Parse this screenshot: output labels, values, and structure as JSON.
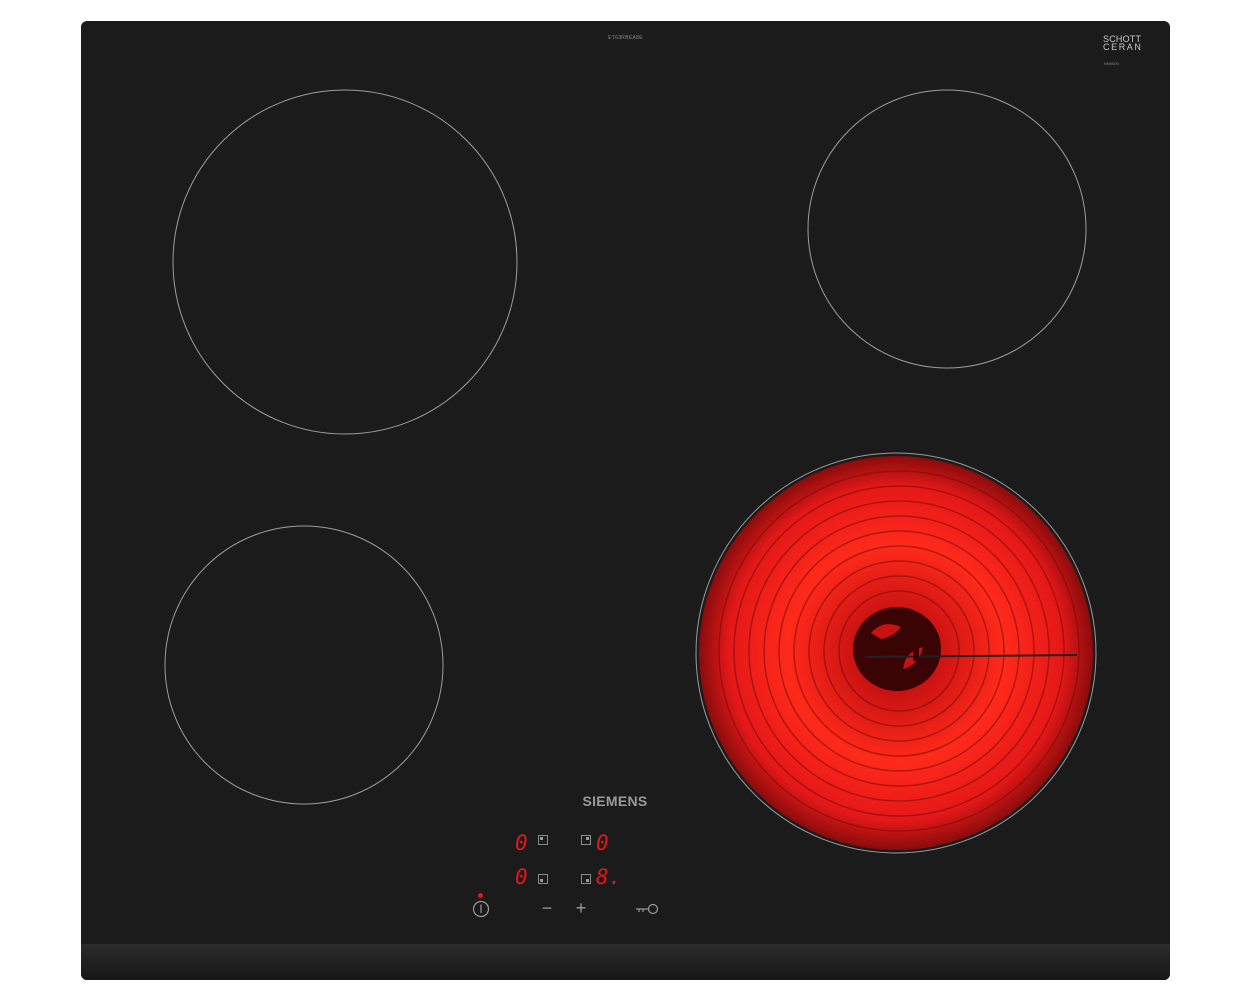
{
  "hob": {
    "model_text": "ET63RBEA8E",
    "glass_brand": {
      "line1": "SCHOTT",
      "line2": "CERAN",
      "sub": "NN0000"
    },
    "brand_logo": "SIEMENS",
    "displays": {
      "top_left": "0",
      "top_right": "0",
      "bottom_left": "0",
      "bottom_right": "8."
    },
    "controls": {
      "power_icon": "power-icon",
      "minus": "−",
      "plus": "+",
      "lock_icon": "key-lock-icon"
    },
    "zones": {
      "active": "front-right",
      "active_color": "#e01a1a",
      "outline_color": "#9c9c9c"
    }
  }
}
